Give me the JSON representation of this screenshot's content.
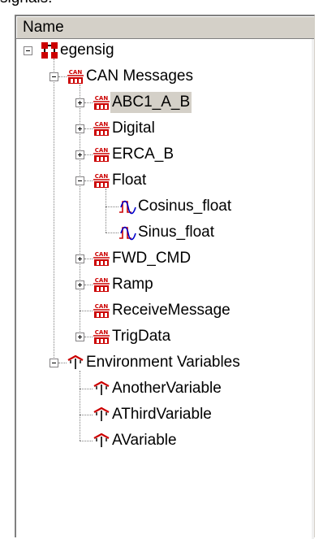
{
  "caption": "signals:",
  "header": {
    "column_label": "Name"
  },
  "tree": {
    "nodes": [
      {
        "label": "egensig",
        "icon": "network-node-icon",
        "expander": "minus",
        "selected": false
      },
      {
        "label": "CAN Messages",
        "icon": "can-icon",
        "expander": "minus",
        "selected": false
      },
      {
        "label": "ABC1_A_B",
        "icon": "can-icon",
        "expander": "plus",
        "selected": true
      },
      {
        "label": "Digital",
        "icon": "can-icon",
        "expander": "plus",
        "selected": false
      },
      {
        "label": "ERCA_B",
        "icon": "can-icon",
        "expander": "plus",
        "selected": false
      },
      {
        "label": "Float",
        "icon": "can-icon",
        "expander": "minus",
        "selected": false
      },
      {
        "label": "Cosinus_float",
        "icon": "signal-icon",
        "expander": "none",
        "selected": false
      },
      {
        "label": "Sinus_float",
        "icon": "signal-icon",
        "expander": "none",
        "selected": false
      },
      {
        "label": "FWD_CMD",
        "icon": "can-icon",
        "expander": "plus",
        "selected": false
      },
      {
        "label": "Ramp",
        "icon": "can-icon",
        "expander": "plus",
        "selected": false
      },
      {
        "label": "ReceiveMessage",
        "icon": "can-icon",
        "expander": "none",
        "selected": false
      },
      {
        "label": "TrigData",
        "icon": "can-icon",
        "expander": "plus",
        "selected": false
      },
      {
        "label": "Environment Variables",
        "icon": "env-var-icon",
        "expander": "minus",
        "selected": false
      },
      {
        "label": "AnotherVariable",
        "icon": "env-var-icon",
        "expander": "none",
        "selected": false
      },
      {
        "label": "AThirdVariable",
        "icon": "env-var-icon",
        "expander": "none",
        "selected": false
      },
      {
        "label": "AVariable",
        "icon": "env-var-icon",
        "expander": "none",
        "selected": false
      }
    ],
    "icon_text": {
      "can": "CAN"
    }
  },
  "colors": {
    "selection_bg": "#d4d0c8",
    "can_icon": "#cc0000",
    "signal_wave": "#0000cc",
    "signal_step": "#cc0000",
    "env_icon": "#cc0000"
  }
}
